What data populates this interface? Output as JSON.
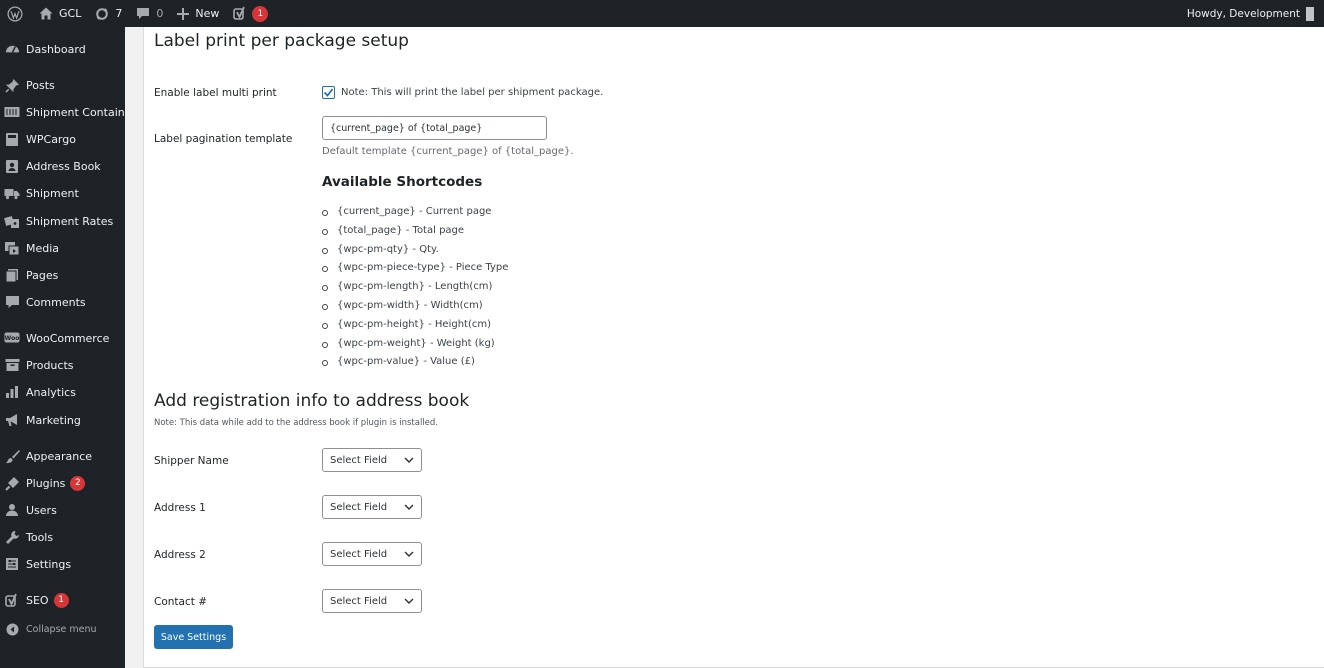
{
  "adminbar": {
    "site_name": "GCL",
    "updates_count": "7",
    "comments_count": "0",
    "new_label": "New",
    "seo_badge": "1",
    "howdy": "Howdy, Development"
  },
  "sidebar": {
    "items": [
      {
        "label": "Dashboard",
        "icon": "dashboard-icon"
      },
      {
        "label": "Posts",
        "icon": "pin-icon"
      },
      {
        "label": "Shipment Container",
        "icon": "container-icon"
      },
      {
        "label": "WPCargo",
        "icon": "book-icon"
      },
      {
        "label": "Address Book",
        "icon": "address-book-icon"
      },
      {
        "label": "Shipment",
        "icon": "truck-icon"
      },
      {
        "label": "Shipment Rates",
        "icon": "rates-icon"
      },
      {
        "label": "Media",
        "icon": "media-icon"
      },
      {
        "label": "Pages",
        "icon": "pages-icon"
      },
      {
        "label": "Comments",
        "icon": "comment-icon"
      },
      {
        "label": "WooCommerce",
        "icon": "woo-icon"
      },
      {
        "label": "Products",
        "icon": "archive-icon"
      },
      {
        "label": "Analytics",
        "icon": "chart-icon"
      },
      {
        "label": "Marketing",
        "icon": "megaphone-icon"
      },
      {
        "label": "Appearance",
        "icon": "brush-icon"
      },
      {
        "label": "Plugins",
        "icon": "plug-icon",
        "badge": "2"
      },
      {
        "label": "Users",
        "icon": "user-icon"
      },
      {
        "label": "Tools",
        "icon": "wrench-icon"
      },
      {
        "label": "Settings",
        "icon": "settings-icon"
      },
      {
        "label": "SEO",
        "icon": "yoast-icon",
        "badge": "1"
      }
    ],
    "collapse_label": "Collapse menu"
  },
  "section1": {
    "title": "Label print per package setup",
    "multi_print_label": "Enable label multi print",
    "multi_print_checked": true,
    "multi_print_note": "Note: This will print the label per shipment package.",
    "pagination_label": "Label pagination template",
    "pagination_value": "{current_page} of {total_page}",
    "pagination_desc": "Default template {current_page} of {total_page}.",
    "shortcodes_title": "Available Shortcodes",
    "shortcodes": [
      "{current_page} - Current page",
      "{total_page} - Total page",
      "{wpc-pm-qty} - Qty.",
      "{wpc-pm-piece-type} - Piece Type",
      "{wpc-pm-length} - Length(cm)",
      "{wpc-pm-width} - Width(cm)",
      "{wpc-pm-height} - Height(cm)",
      "{wpc-pm-weight} - Weight (kg)",
      "{wpc-pm-value} - Value (£)"
    ]
  },
  "section2": {
    "title": "Add registration info to address book",
    "note": "Note: This data while add to the address book if plugin is installed.",
    "fields": [
      {
        "label": "Shipper Name",
        "value": "Select Field"
      },
      {
        "label": "Address 1",
        "value": "Select Field"
      },
      {
        "label": "Address 2",
        "value": "Select Field"
      },
      {
        "label": "Contact #",
        "value": "Select Field"
      }
    ],
    "save_label": "Save Settings"
  },
  "colors": {
    "adminbar_bg": "#1d2327",
    "primary": "#2271b1",
    "badge": "#d63638"
  }
}
